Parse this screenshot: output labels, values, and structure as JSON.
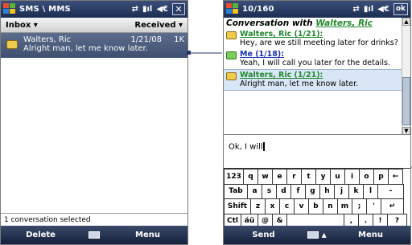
{
  "left": {
    "title": "SMS \\ MMS",
    "close": "✕",
    "folder": "Inbox ▾",
    "sort": "Received ▾",
    "message": {
      "from": "Walters, Ric",
      "date": "1/21/08",
      "size": "1K",
      "preview": "Alright man, let me know later."
    },
    "status": "1 conversation selected",
    "softkeys": {
      "left": "Delete",
      "right": "Menu"
    }
  },
  "right": {
    "title": "10/160",
    "ok": "ok",
    "conversation_label": "Conversation with",
    "conversation_name": "Walters, Ric",
    "messages": [
      {
        "sender": "Walters, Ric (1/21):",
        "body": "Hey, are we still meeting later for drinks?",
        "color": "#22882c",
        "icon": "incoming-envelope-icon"
      },
      {
        "sender": "Me (1/18):",
        "body": "Yeah, I will call you later for the details.",
        "color": "#1b2fae",
        "icon": "outgoing-envelope-icon"
      },
      {
        "sender": "Walters, Ric (1/21):",
        "body": "Alright man, let me know later.",
        "color": "#22882c",
        "icon": "incoming-envelope-icon"
      }
    ],
    "compose_text": "Ok, I will",
    "keyboard": {
      "row1": [
        "123",
        "q",
        "w",
        "e",
        "r",
        "t",
        "y",
        "u",
        "i",
        "o",
        "p",
        "←"
      ],
      "row2": [
        "Tab",
        "a",
        "s",
        "d",
        "f",
        "g",
        "h",
        "j",
        "k",
        "l",
        "-"
      ],
      "row3": [
        "Shift",
        "z",
        "x",
        "c",
        "v",
        "b",
        "n",
        "m",
        ";",
        "'",
        "↵"
      ],
      "row4": [
        "Ctl",
        "áü",
        "@",
        "&",
        "",
        ",",
        ".",
        "!",
        "?"
      ]
    },
    "softkeys": {
      "left": "Send",
      "right": "Menu"
    }
  },
  "colors": {
    "titlebar": "#1c2d52",
    "selection": "#4a5a7a",
    "accent_green": "#22882c",
    "accent_blue": "#1b2fae"
  }
}
